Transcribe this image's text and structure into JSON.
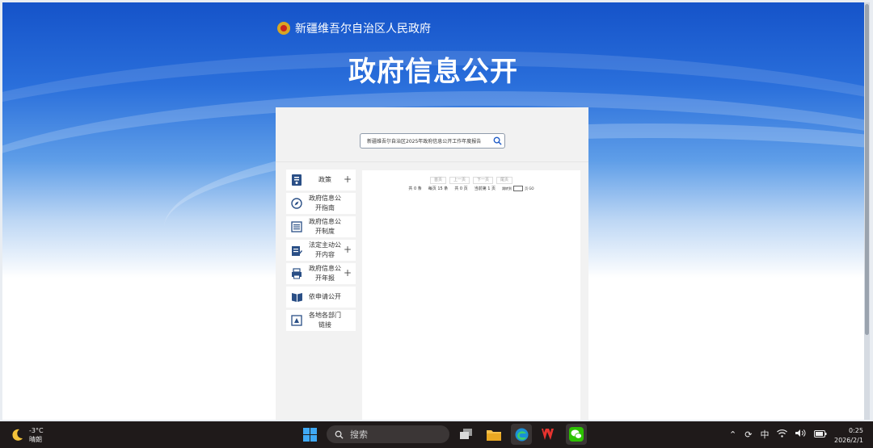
{
  "header": {
    "site_name": "新疆维吾尔自治区人民政府",
    "page_title": "政府信息公开"
  },
  "search": {
    "query": "新疆维吾尔自治区2025年政府信息公开工作年度报告"
  },
  "sidebar": {
    "items": [
      {
        "label": "政策",
        "icon": "document-icon",
        "expandable": true
      },
      {
        "label": "政府信息公开指南",
        "icon": "compass-icon",
        "expandable": false
      },
      {
        "label": "政府信息公开制度",
        "icon": "list-icon",
        "expandable": false
      },
      {
        "label": "法定主动公开内容",
        "icon": "clipboard-edit-icon",
        "expandable": true
      },
      {
        "label": "政府信息公开年报",
        "icon": "printer-icon",
        "expandable": true
      },
      {
        "label": "依申请公开",
        "icon": "book-icon",
        "expandable": false
      },
      {
        "label": "各地各部门链接",
        "icon": "link-icon",
        "expandable": false
      }
    ]
  },
  "pagination": {
    "first": "首页",
    "prev": "上一页",
    "next": "下一页",
    "last": "尾页",
    "total": "共 0 条",
    "per_page": "每页 15 条",
    "pages": "共 0 页",
    "current": "当前第 1 页",
    "goto_prefix": "跳转到",
    "goto_suffix": "页 GO"
  },
  "taskbar": {
    "temperature": "-3°C",
    "weather": "晴朗",
    "search_label": "搜索",
    "ime": "中",
    "time": "0:25",
    "date": "2026/2/1"
  },
  "colors": {
    "banner_blue": "#1553c9",
    "panel_bg": "#f2f2f2",
    "taskbar_bg": "#1f1a1a"
  }
}
